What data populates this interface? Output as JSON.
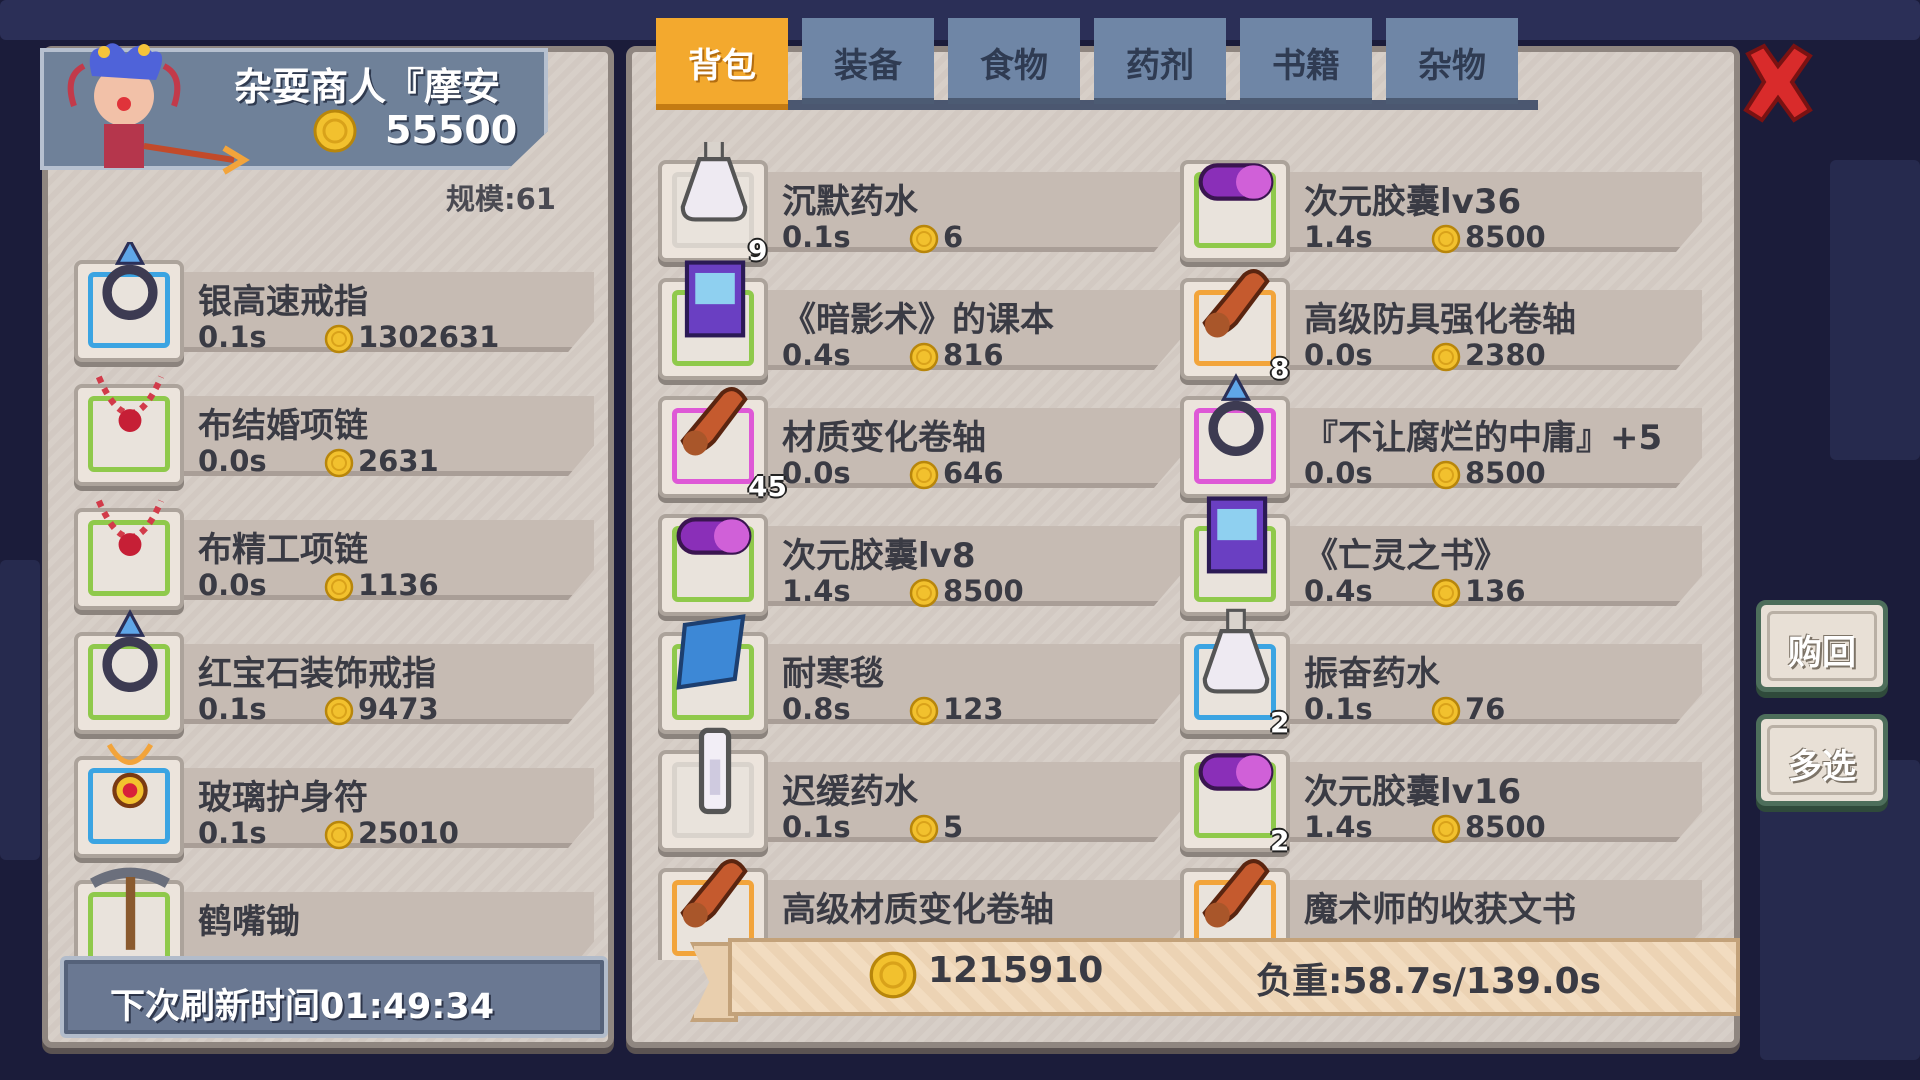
{
  "colors": {
    "accent_tab": "#f3a92e",
    "tab": "#6f86a6",
    "panel": "#d9d1c9",
    "close": "#d92b2b"
  },
  "merchant": {
    "name": "杂耍商人『摩安",
    "gold": "55500",
    "scale": "规模:61"
  },
  "merchant_items": [
    {
      "name": "银高速戒指",
      "weight": "0.1s",
      "price": "1302631",
      "frame": "blue",
      "icon": "ring-icon"
    },
    {
      "name": "布结婚项链",
      "weight": "0.0s",
      "price": "2631",
      "frame": "green",
      "icon": "necklace-icon"
    },
    {
      "name": "布精工项链",
      "weight": "0.0s",
      "price": "1136",
      "frame": "green",
      "icon": "necklace-icon"
    },
    {
      "name": "红宝石装饰戒指",
      "weight": "0.1s",
      "price": "9473",
      "frame": "green",
      "icon": "ring-icon"
    },
    {
      "name": "玻璃护身符",
      "weight": "0.1s",
      "price": "25010",
      "frame": "blue",
      "icon": "amulet-icon"
    },
    {
      "name": "鹤嘴锄",
      "weight": "",
      "price": "",
      "frame": "green",
      "icon": "pickaxe-icon"
    }
  ],
  "refresh": "下次刷新时间01:49:34",
  "tabs": [
    "背包",
    "装备",
    "食物",
    "药剂",
    "书籍",
    "杂物"
  ],
  "bag_items": [
    {
      "name": "沉默药水",
      "weight": "0.1s",
      "price": "6",
      "qty": "9",
      "frame": "white",
      "icon": "potion-icon"
    },
    {
      "name": "次元胶囊lv36",
      "weight": "1.4s",
      "price": "8500",
      "qty": "",
      "frame": "green",
      "icon": "capsule-icon"
    },
    {
      "name": "《暗影术》的课本",
      "weight": "0.4s",
      "price": "816",
      "qty": "",
      "frame": "green",
      "icon": "book-icon"
    },
    {
      "name": "高级防具强化卷轴",
      "weight": "0.0s",
      "price": "2380",
      "qty": "8",
      "frame": "orange",
      "icon": "scroll-icon"
    },
    {
      "name": "材质变化卷轴",
      "weight": "0.0s",
      "price": "646",
      "qty": "45",
      "frame": "pink",
      "icon": "scroll-icon"
    },
    {
      "name": "『不让腐烂的中庸』+5",
      "weight": "0.0s",
      "price": "8500",
      "qty": "",
      "frame": "pink",
      "icon": "ring-icon"
    },
    {
      "name": "次元胶囊lv8",
      "weight": "1.4s",
      "price": "8500",
      "qty": "",
      "frame": "green",
      "icon": "capsule-icon"
    },
    {
      "name": "《亡灵之书》",
      "weight": "0.4s",
      "price": "136",
      "qty": "",
      "frame": "green",
      "icon": "book-icon"
    },
    {
      "name": "耐寒毯",
      "weight": "0.8s",
      "price": "123",
      "qty": "",
      "frame": "green",
      "icon": "blanket-icon"
    },
    {
      "name": "振奋药水",
      "weight": "0.1s",
      "price": "76",
      "qty": "2",
      "frame": "blue",
      "icon": "potion-icon"
    },
    {
      "name": "迟缓药水",
      "weight": "0.1s",
      "price": "5",
      "qty": "",
      "frame": "white",
      "icon": "vial-icon"
    },
    {
      "name": "次元胶囊lv16",
      "weight": "1.4s",
      "price": "8500",
      "qty": "2",
      "frame": "green",
      "icon": "capsule-icon"
    },
    {
      "name": "高级材质变化卷轴",
      "weight": "",
      "price": "",
      "qty": "",
      "frame": "orange",
      "icon": "scroll-icon"
    },
    {
      "name": "魔术师的收获文书",
      "weight": "",
      "price": "",
      "qty": "",
      "frame": "orange",
      "icon": "scroll-icon"
    }
  ],
  "buttons": {
    "buyback": "购回",
    "multi": "多选"
  },
  "footer": {
    "gold": "1215910",
    "load": "负重:58.7s/139.0s"
  }
}
